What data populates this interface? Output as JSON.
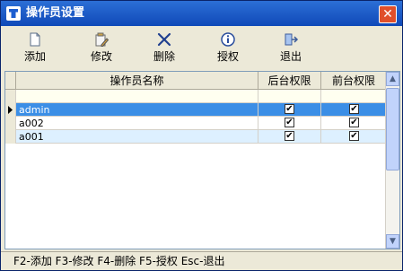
{
  "window": {
    "title": "操作员设置"
  },
  "toolbar": {
    "items": [
      {
        "label": "添加",
        "icon": "document-icon"
      },
      {
        "label": "修改",
        "icon": "edit-icon"
      },
      {
        "label": "删除",
        "icon": "delete-icon"
      },
      {
        "label": "授权",
        "icon": "info-icon"
      },
      {
        "label": "退出",
        "icon": "exit-icon"
      }
    ]
  },
  "grid": {
    "columns": [
      "操作员名称",
      "后台权限",
      "前台权限"
    ],
    "rows": [
      {
        "name": "admin",
        "backend": true,
        "frontend": true,
        "selected": true
      },
      {
        "name": "a002",
        "backend": true,
        "frontend": true,
        "selected": false
      },
      {
        "name": "a001",
        "backend": true,
        "frontend": true,
        "selected": false
      }
    ],
    "check_mark": "✔"
  },
  "statusbar": {
    "text": "F2-添加 F3-修改 F4-删除 F5-授权 Esc-退出"
  },
  "colors": {
    "titlebar": "#1558c4",
    "selection": "#3b8ee6",
    "alt_row": "#ddf0ff"
  }
}
